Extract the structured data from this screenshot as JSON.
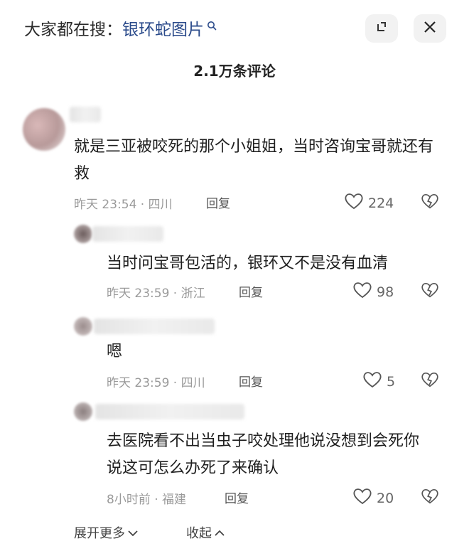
{
  "header": {
    "search_prefix": "大家都在搜：",
    "search_term": "银环蛇图片",
    "comment_count": "2.1万条评论"
  },
  "comments": [
    {
      "text": "就是三亚被咬死的那个小姐姐，当时咨询宝哥就还有救",
      "meta": "昨天 23:54 · 四川",
      "reply": "回复",
      "likes": "224"
    },
    {
      "text": "当时问宝哥包活的，银环又不是没有血清",
      "meta": "昨天 23:59 · 浙江",
      "reply": "回复",
      "likes": "98"
    },
    {
      "text": "嗯",
      "meta": "昨天 23:59 · 四川",
      "reply": "回复",
      "likes": "5"
    },
    {
      "text": "去医院看不出当虫子咬处理他说没想到会死你说这可怎么办死了来确认",
      "meta": "8小时前 · 福建",
      "reply": "回复",
      "likes": "20"
    }
  ],
  "footer": {
    "expand_label": "展开更多",
    "collapse_label": "收起"
  },
  "colors": {
    "search_term": "#2a4a8a",
    "meta": "#9a9a9a"
  }
}
